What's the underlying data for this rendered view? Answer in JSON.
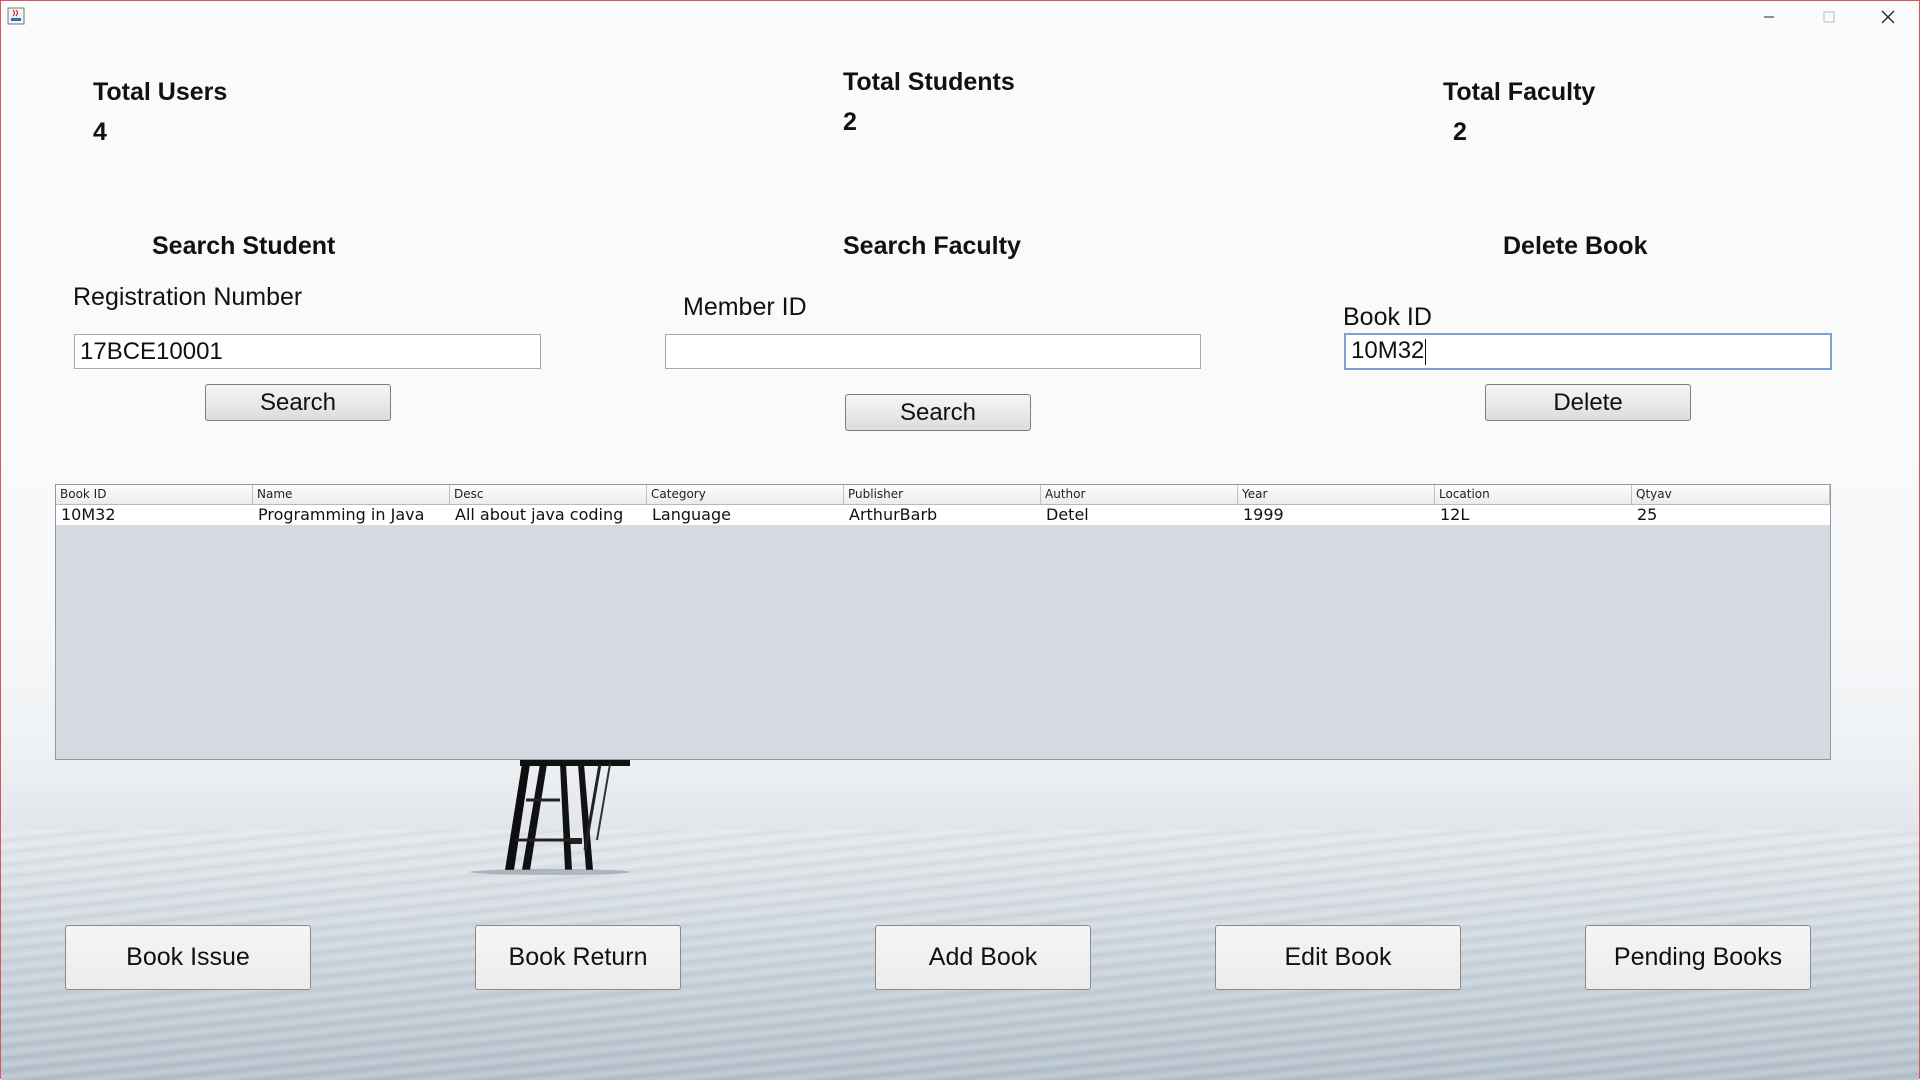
{
  "window": {
    "app_icon": "java-app-icon",
    "controls": [
      "minimize-icon",
      "maximize-icon",
      "close-icon"
    ]
  },
  "stats": {
    "total_users_label": "Total Users",
    "total_users_value": "4",
    "total_students_label": "Total Students",
    "total_students_value": "2",
    "total_faculty_label": "Total Faculty",
    "total_faculty_value": "2"
  },
  "search_student": {
    "title": "Search Student",
    "field_label": "Registration Number",
    "field_value": "17BCE10001",
    "button_label": "Search"
  },
  "search_faculty": {
    "title": "Search Faculty",
    "field_label": "Member ID",
    "field_value": "",
    "button_label": "Search"
  },
  "delete_book": {
    "title": "Delete Book",
    "field_label": "Book ID",
    "field_value": "10M32",
    "button_label": "Delete"
  },
  "table": {
    "columns": [
      "Book ID",
      "Name",
      "Desc",
      "Category",
      "Publisher",
      "Author",
      "Year",
      "Location",
      "Qtyav"
    ],
    "rows": [
      [
        "10M32",
        "Programming in Java",
        "All about java coding",
        "Language",
        "ArthurBarb",
        "Detel",
        "1999",
        "12L",
        "25"
      ]
    ]
  },
  "actions": {
    "book_issue": "Book Issue",
    "book_return": "Book Return",
    "add_book": "Add Book",
    "edit_book": "Edit Book",
    "pending_books": "Pending Books"
  },
  "colors": {
    "frame_border": "#d3575d",
    "input_focus": "#7aa3cf",
    "table_empty_bg": "#d6d9df"
  }
}
